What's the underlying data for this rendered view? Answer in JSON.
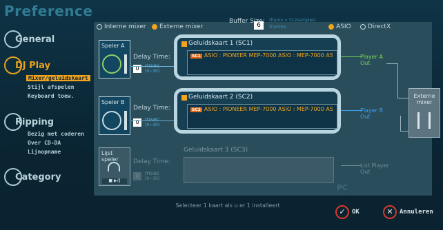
{
  "app": {
    "title": "Preference"
  },
  "sidebar": {
    "categories": [
      {
        "label": "General"
      },
      {
        "label": "DJ Play"
      },
      {
        "label": "Ripping"
      },
      {
        "label": "Category"
      }
    ],
    "dj_play_items": [
      "Mixer/geluidskaart",
      "Stijl afspelen",
      "Keyboard toew."
    ],
    "ripping_items": [
      "Bezig met coderen",
      "Over CD-DA",
      "Lijnopname"
    ]
  },
  "topbar": {
    "mixer_internal": "Interne mixer",
    "mixer_external": "Externe mixer",
    "buffer_label": "Buffer Size:",
    "buffer_value": "6",
    "buffer_note": "(frame = 512samples)",
    "buffer_unit": "frames",
    "asio": "ASIO",
    "directx": "DirectX"
  },
  "players": [
    {
      "label": "Speler A",
      "delay_label": "Delay Time:",
      "delay_value": "0",
      "unit": "msec",
      "range": "(0~30)"
    },
    {
      "label": "Speler B",
      "delay_label": "Delay Time:",
      "delay_value": "0",
      "unit": "msec",
      "range": "(0~30)"
    },
    {
      "label": "Lijst speler",
      "delay_label": "Delay Time:",
      "delay_value": "0",
      "unit": "msec",
      "range": "(0~30)"
    }
  ],
  "cards": [
    {
      "title": "Geluidskaart 1 (SC1)",
      "badge": "SC1",
      "device": "ASIO : PIONEER MEP-7000 ASIO : MEP-7000 ASIO"
    },
    {
      "title": "Geluidskaart 2 (SC2)",
      "badge": "SC2",
      "device": "ASIO : PIONEER MEP-7000 ASIO : MEP-7000 ASIO"
    },
    {
      "title": "Geluidskaart 3 (SC3)",
      "badge": "",
      "device": ""
    }
  ],
  "outputs": {
    "player_a": [
      "Player A",
      "Out"
    ],
    "player_b": [
      "Player B",
      "Out"
    ],
    "list_player": [
      "List Player",
      "Out"
    ]
  },
  "mixer": {
    "label": [
      "Externe",
      "mixer"
    ]
  },
  "footer": {
    "status": "Selecteer 1 kaart als u er 1 installeert",
    "pc_mark": "PC",
    "ok": "OK",
    "cancel": "Annuleren"
  },
  "colors": {
    "accent": "#f2a51c",
    "green": "#7ad84a",
    "blue": "#3fa0ea",
    "cancel_ring": "#d33b2c"
  },
  "icons": {
    "ok": "check-icon",
    "cancel": "x-icon"
  }
}
